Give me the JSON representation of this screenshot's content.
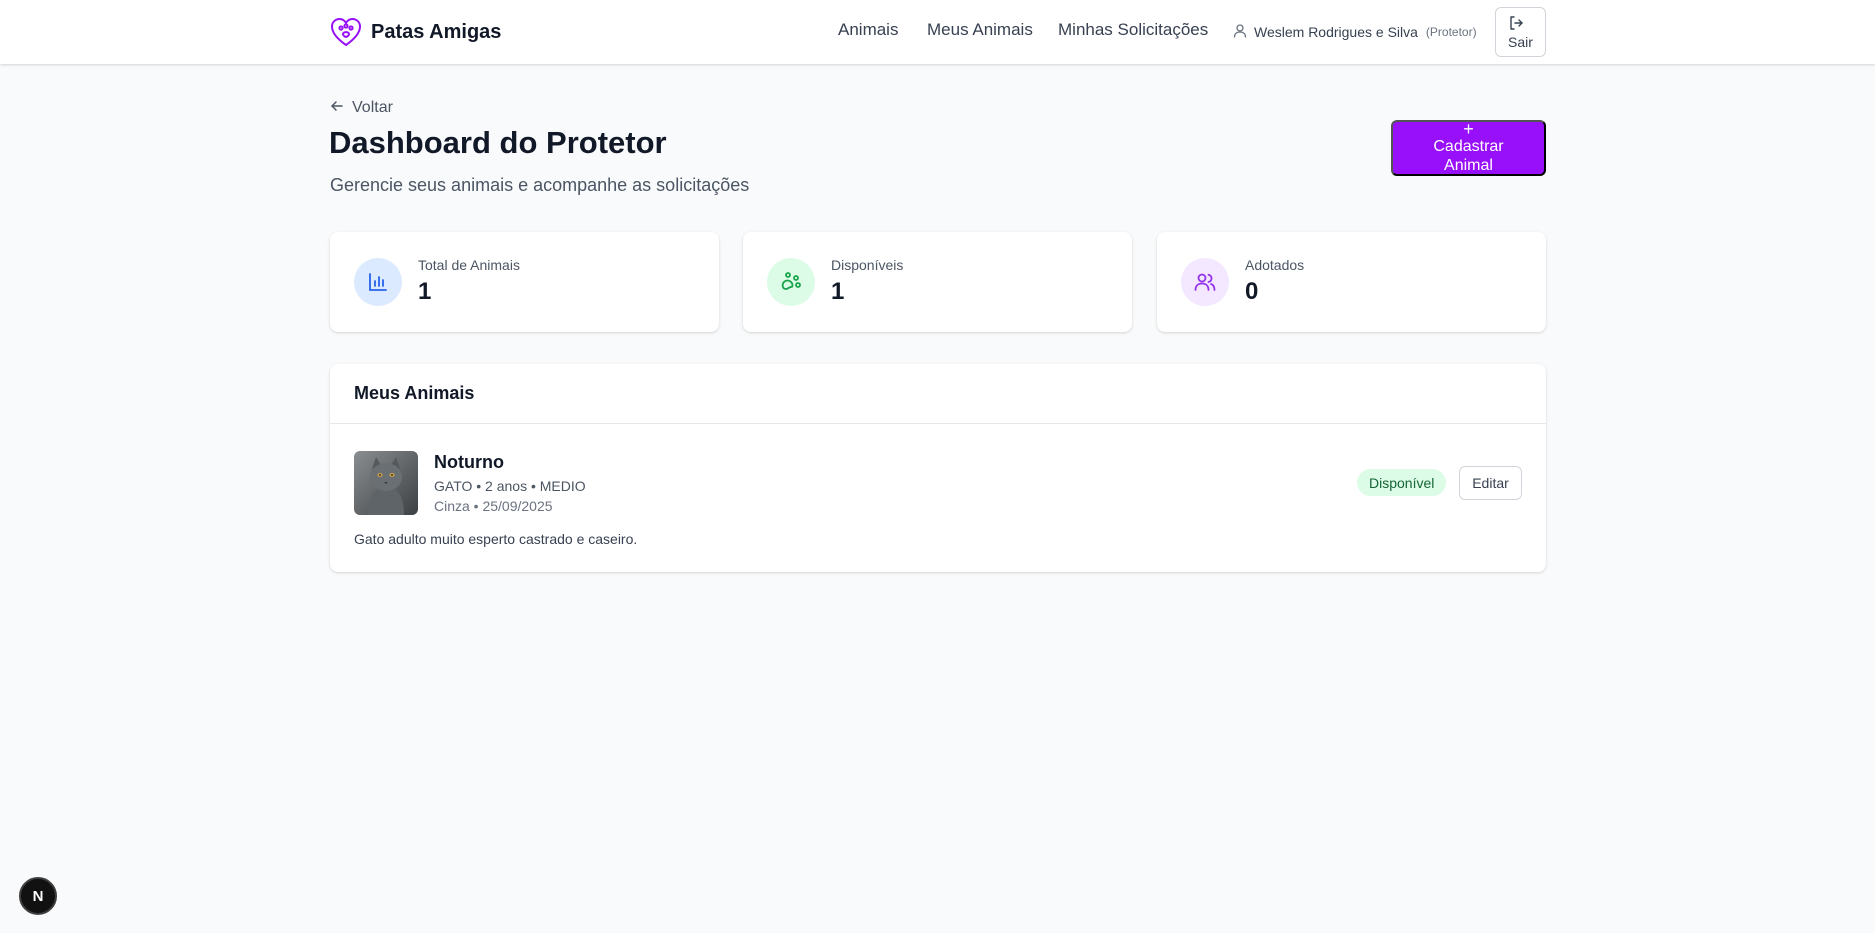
{
  "header": {
    "brand": "Patas Amigas",
    "nav": [
      "Animais",
      "Meus Animais",
      "Minhas Solicitações"
    ],
    "user_name": "Weslem Rodrigues e Silva",
    "user_role": "(Protetor)",
    "logout_label": "Sair"
  },
  "page": {
    "back_label": "Voltar",
    "title": "Dashboard do Protetor",
    "subtitle": "Gerencie seus animais e acompanhe as solicitações",
    "add_button_plus": "+",
    "add_button_label": "Cadastrar Animal"
  },
  "stats": [
    {
      "label": "Total de Animais",
      "value": "1",
      "icon": "chart-icon"
    },
    {
      "label": "Disponíveis",
      "value": "1",
      "icon": "paw-icon"
    },
    {
      "label": "Adotados",
      "value": "0",
      "icon": "users-icon"
    }
  ],
  "animals_section": {
    "title": "Meus Animais",
    "items": [
      {
        "name": "Noturno",
        "meta": "GATO • 2 anos • MEDIO",
        "meta2": "Cinza • 25/09/2025",
        "description": "Gato adulto muito esperto castrado e caseiro.",
        "status": "Disponível",
        "edit_label": "Editar"
      }
    ]
  },
  "floating_badge": "N",
  "colors": {
    "accent": "#9810fa",
    "stat_blue_bg": "#dbeafe",
    "stat_green_bg": "#dcfce7",
    "stat_purple_bg": "#f3e8ff",
    "status_bg": "#dcfce7",
    "status_text": "#166534"
  }
}
